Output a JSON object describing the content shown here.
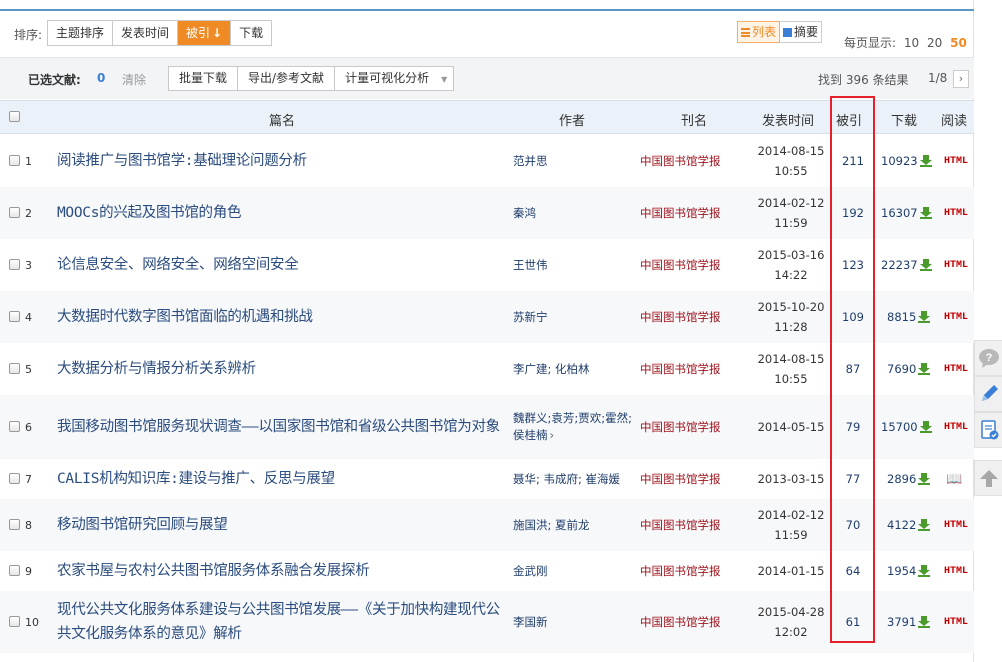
{
  "sort": {
    "label": "排序:",
    "options": [
      "主题排序",
      "发表时间",
      "被引",
      "下载"
    ],
    "active_arrow": "↓"
  },
  "view": {
    "list_label": "列表",
    "abstract_label": "摘要"
  },
  "per_page": {
    "label": "每页显示:",
    "options": [
      "10",
      "20",
      "50"
    ]
  },
  "selection": {
    "label": "已选文献:",
    "count": "0",
    "clear": "清除",
    "actions": [
      "批量下载",
      "导出/参考文献",
      "计量可视化分析"
    ]
  },
  "results": {
    "found": "找到 396 条结果",
    "page": "1/8",
    "next": "›"
  },
  "table": {
    "headers": {
      "title": "篇名",
      "author": "作者",
      "journal": "刊名",
      "date": "发表时间",
      "cited": "被引",
      "download": "下载",
      "read": "阅读"
    },
    "rows": [
      {
        "num": "1",
        "title": "阅读推广与图书馆学:基础理论问题分析",
        "author": "范并思",
        "journal": "中国图书馆学报",
        "date": "2014-08-15",
        "time": "10:55",
        "cited": "211",
        "downloads": "10923",
        "read": "HTML"
      },
      {
        "num": "2",
        "title": "MOOCs的兴起及图书馆的角色",
        "author": "秦鸿",
        "journal": "中国图书馆学报",
        "date": "2014-02-12",
        "time": "11:59",
        "cited": "192",
        "downloads": "16307",
        "read": "HTML"
      },
      {
        "num": "3",
        "title": "论信息安全、网络安全、网络空间安全",
        "author": "王世伟",
        "journal": "中国图书馆学报",
        "date": "2015-03-16",
        "time": "14:22",
        "cited": "123",
        "downloads": "22237",
        "read": "HTML"
      },
      {
        "num": "4",
        "title": "大数据时代数字图书馆面临的机遇和挑战",
        "author": "苏新宁",
        "journal": "中国图书馆学报",
        "date": "2015-10-20",
        "time": "11:28",
        "cited": "109",
        "downloads": "8815",
        "read": "HTML"
      },
      {
        "num": "5",
        "title": "大数据分析与情报分析关系辨析",
        "author": "李广建; 化柏林",
        "journal": "中国图书馆学报",
        "date": "2014-08-15",
        "time": "10:55",
        "cited": "87",
        "downloads": "7690",
        "read": "HTML"
      },
      {
        "num": "6",
        "title": "我国移动图书馆服务现状调查——以国家图书馆和省级公共图书馆为对象",
        "author": "魏群义;袁芳;贾欢;霍然;侯桂楠",
        "author_more": "›",
        "journal": "中国图书馆学报",
        "date": "2014-05-15",
        "time": "",
        "cited": "79",
        "downloads": "15700",
        "read": "HTML"
      },
      {
        "num": "7",
        "title": "CALIS机构知识库:建设与推广、反思与展望",
        "author": "聂华; 韦成府; 崔海媛",
        "journal": "中国图书馆学报",
        "date": "2013-03-15",
        "time": "",
        "cited": "77",
        "downloads": "2896",
        "read": "📖"
      },
      {
        "num": "8",
        "title": "移动图书馆研究回顾与展望",
        "author": "施国洪; 夏前龙",
        "journal": "中国图书馆学报",
        "date": "2014-02-12",
        "time": "11:59",
        "cited": "70",
        "downloads": "4122",
        "read": "HTML"
      },
      {
        "num": "9",
        "title": "农家书屋与农村公共图书馆服务体系融合发展探析",
        "author": "金武刚",
        "journal": "中国图书馆学报",
        "date": "2014-01-15",
        "time": "",
        "cited": "64",
        "downloads": "1954",
        "read": "HTML"
      },
      {
        "num": "10",
        "title": "现代公共文化服务体系建设与公共图书馆发展——《关于加快构建现代公共文化服务体系的意见》解析",
        "author": "李国新",
        "journal": "中国图书馆学报",
        "date": "2015-04-28",
        "time": "12:02",
        "cited": "61",
        "downloads": "3791",
        "read": "HTML"
      }
    ]
  },
  "colors": {
    "accent_orange": "#f08a24",
    "journal_red": "#a0141e",
    "highlight_red": "#e4202a",
    "title_blue": "#2b4c7e",
    "header_bg": "#ebf1f8"
  },
  "side_tools": [
    "question-icon",
    "pencil-icon",
    "clipboard-check-icon",
    "arrow-up-icon"
  ]
}
